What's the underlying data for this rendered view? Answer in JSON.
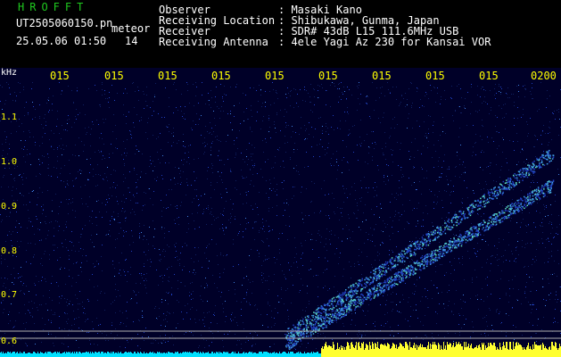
{
  "header": {
    "app_title": "HROFFT",
    "filename": "UT2505060150.pn",
    "filename_suffix": "meteor",
    "timestamp": "25.05.06 01:50",
    "count": "14",
    "meta": [
      {
        "key": "Observer",
        "value": ": Masaki Kano"
      },
      {
        "key": "Receiving Location",
        "value": ": Shibukawa, Gunma, Japan"
      },
      {
        "key": "Receiver",
        "value": ": SDR# 43dB L15 111.6MHz USB"
      },
      {
        "key": "Receiving Antenna",
        "value": ": 4ele Yagi Az 230 for Kansai VOR"
      }
    ]
  },
  "spectrogram": {
    "y_unit": "kHz",
    "y_ticks": [
      "1.1",
      "1.0",
      "0.9",
      "0.8",
      "0.7",
      "0.6"
    ],
    "time_labels": [
      "015",
      "015",
      "015",
      "015",
      "015",
      "015",
      "015",
      "015",
      "015",
      "0200"
    ],
    "colors": {
      "background": "#000030",
      "noise": "#2040c0",
      "signal": "#60e0c0",
      "baseline_cyan": "#00e0ff",
      "baseline_yellow": "#ffff30",
      "labels": "#ffff00"
    }
  }
}
